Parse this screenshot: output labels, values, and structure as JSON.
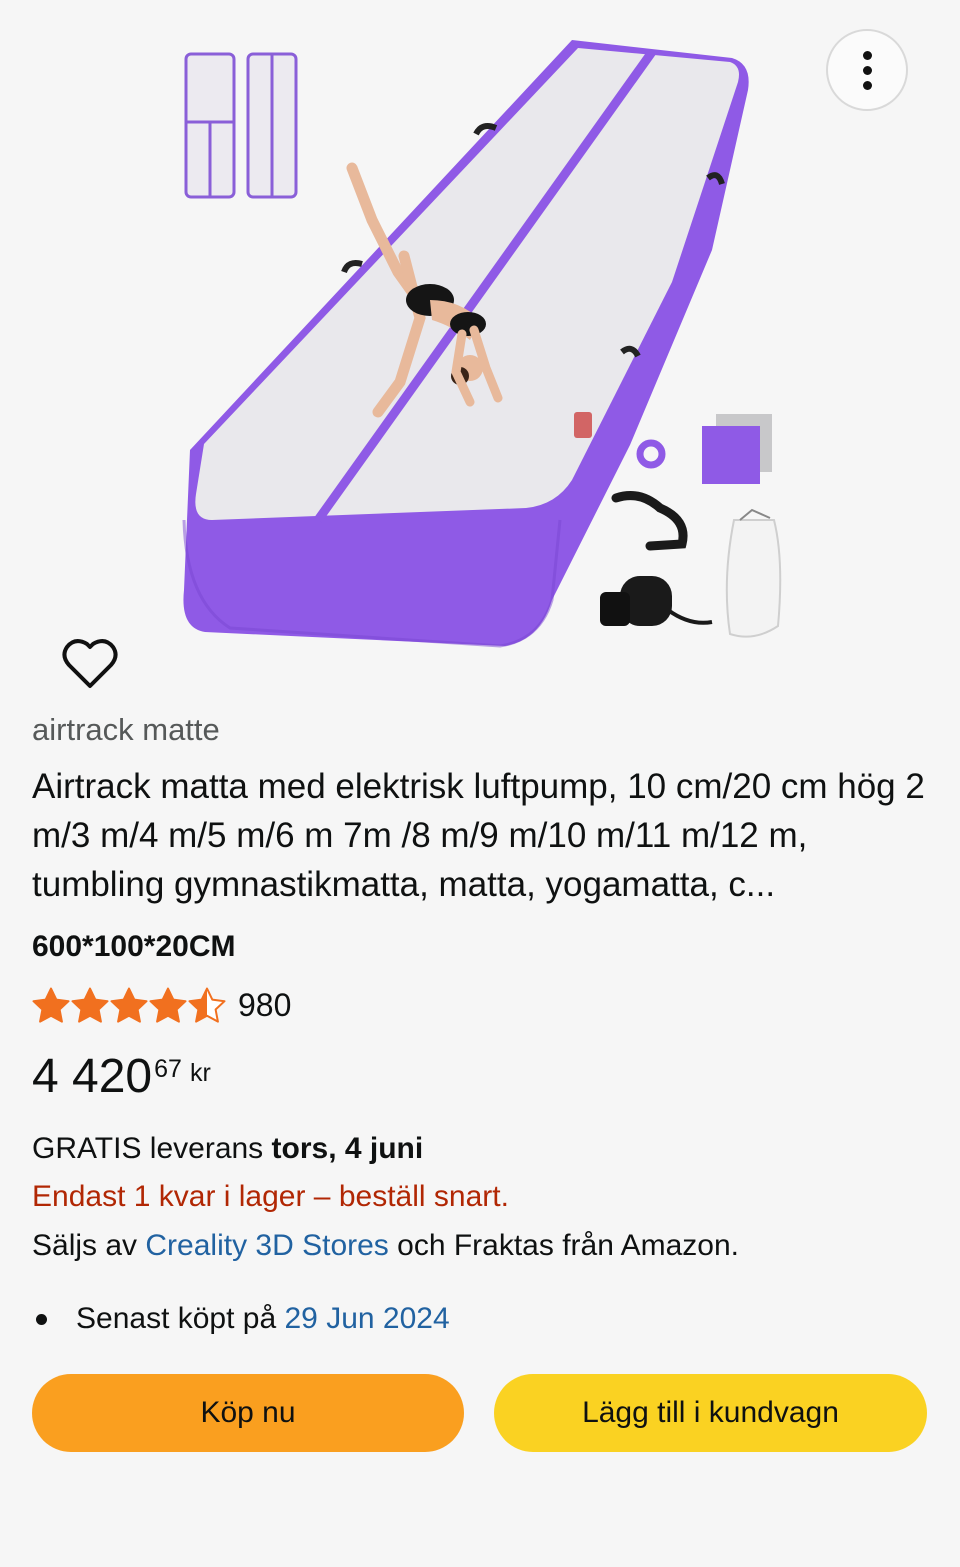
{
  "product": {
    "brand": "airtrack matte",
    "title": "Airtrack matta med elektrisk luftpump, 10 cm/20 cm hög 2 m/3 m/4 m/5 m/6 m 7m /8 m/9 m/10 m/11 m/12 m, tumbling gymnastikmatta, matta, yogamatta, c...",
    "variant": "600*100*20CM",
    "rating_stars": 4.5,
    "rating_count": "980",
    "price": {
      "whole": "4 420",
      "fraction": "67",
      "currency": "kr"
    }
  },
  "delivery": {
    "prefix": "GRATIS leverans ",
    "date": "tors, 4 juni",
    "stock": "Endast 1 kvar i lager – beställ snart.",
    "seller_prefix": "Säljs av ",
    "seller_name": "Creality 3D Stores",
    "seller_suffix": " och Fraktas från Amazon."
  },
  "purchase_history": {
    "prefix": "Senast köpt på ",
    "date": "29 Jun 2024"
  },
  "buttons": {
    "buy_now": "Köp nu",
    "add_to_cart": "Lägg till i kundvagn"
  },
  "icons": {
    "more": "more-vertical-icon",
    "wishlist": "heart-outline-icon",
    "star": "star-icon"
  },
  "colors": {
    "background": "#f6f6f6",
    "buy_now": "#fa9f1f",
    "add_to_cart": "#fad222",
    "star": "#f1701f",
    "link": "#2162a1",
    "stock_warning": "#b12704",
    "mat_purple": "#8f5ae6"
  }
}
